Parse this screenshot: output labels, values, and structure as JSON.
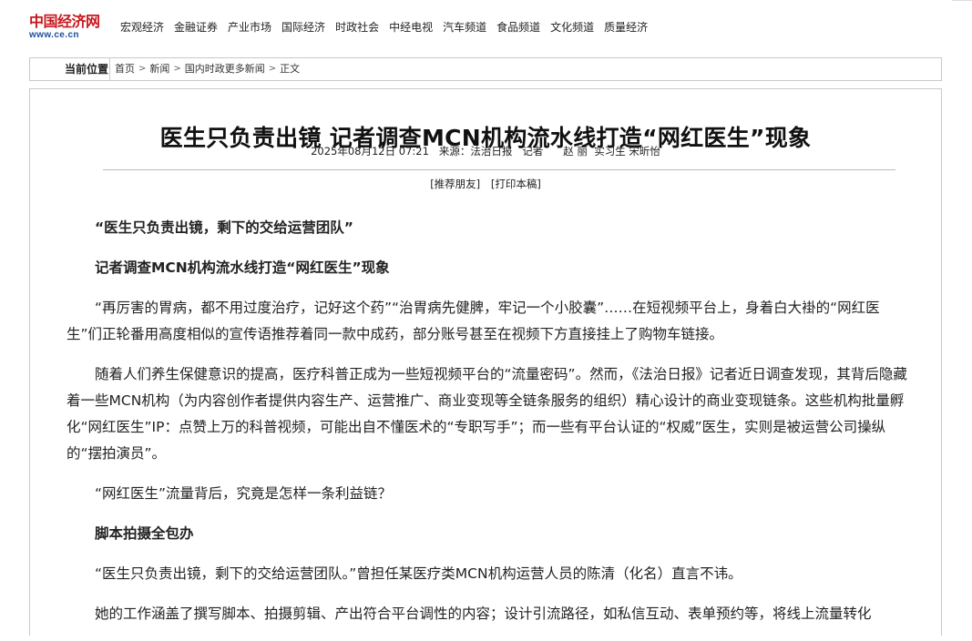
{
  "logo": {
    "text": "中国经济网",
    "url": "www.ce.cn"
  },
  "nav": [
    "宏观经济",
    "金融证券",
    "产业市场",
    "国际经济",
    "时政社会",
    "中经电视",
    "汽车频道",
    "食品频道",
    "文化频道",
    "质量经济"
  ],
  "breadcrumb": {
    "label": "当前位置",
    "items": [
      "首页",
      "新闻",
      "国内时政更多新闻",
      "正文"
    ],
    "separator": ">"
  },
  "article": {
    "title": "医生只负责出镜 记者调查MCN机构流水线打造“网红医生”现象",
    "meta": "2025年08月12日 07:21   来源：法治日报   记者      赵 丽  实习生 宋昕怡",
    "tools": [
      "[推荐朋友]",
      "[打印本稿]"
    ],
    "paragraphs": [
      {
        "text": "“医生只负责出镜，剩下的交给运营团队”",
        "bold": true
      },
      {
        "text": "记者调查MCN机构流水线打造“网红医生”现象",
        "bold": true
      },
      {
        "text": "“再厉害的胃病，都不用过度治疗，记好这个药”“治胃病先健脾，牢记一个小胶囊”……在短视频平台上，身着白大褂的“网红医生”们正轮番用高度相似的宣传语推荐着同一款中成药，部分账号甚至在视频下方直接挂上了购物车链接。",
        "bold": false
      },
      {
        "text": "随着人们养生保健意识的提高，医疗科普正成为一些短视频平台的“流量密码”。然而，《法治日报》记者近日调查发现，其背后隐藏着一些MCN机构（为内容创作者提供内容生产、运营推广、商业变现等全链条服务的组织）精心设计的商业变现链条。这些机构批量孵化“网红医生”IP：点赞上万的科普视频，可能出自不懂医术的“专职写手”；而一些有平台认证的“权威”医生，实则是被运营公司操纵的“摆拍演员”。",
        "bold": false
      },
      {
        "text": "“网红医生”流量背后，究竟是怎样一条利益链？",
        "bold": false
      },
      {
        "text": "脚本拍摄全包办",
        "bold": true
      },
      {
        "text": "“医生只负责出镜，剩下的交给运营团队。”曾担任某医疗类MCN机构运营人员的陈清（化名）直言不讳。",
        "bold": false
      },
      {
        "text": "她的工作涵盖了撰写脚本、拍摄剪辑、产出符合平台调性的内容；设计引流路径，如私信互动、表单预约等，将线上流量转化",
        "bold": false
      }
    ]
  }
}
